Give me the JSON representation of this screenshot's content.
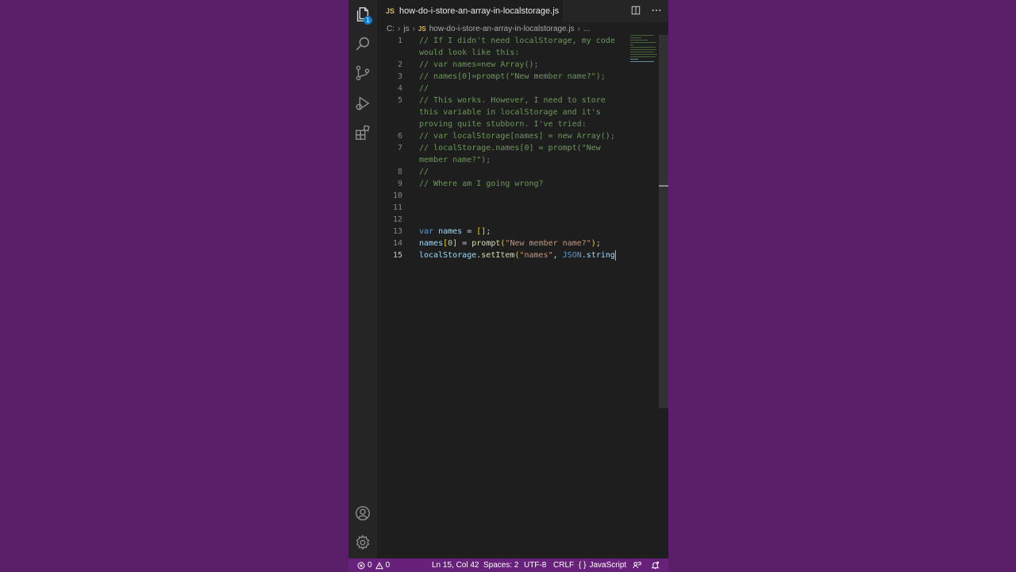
{
  "colors": {
    "background": "#5b1f6a",
    "editor_bg": "#1e1e1e",
    "statusbar_bg": "#68217a",
    "comment": "#6a9955",
    "keyword": "#569cd6",
    "string": "#ce9178"
  },
  "activity_bar": {
    "items": [
      {
        "icon": "files-icon",
        "badge": "1"
      },
      {
        "icon": "search-icon"
      },
      {
        "icon": "source-control-icon"
      },
      {
        "icon": "run-debug-icon"
      },
      {
        "icon": "extensions-icon"
      }
    ],
    "bottom": [
      {
        "icon": "account-icon"
      },
      {
        "icon": "gear-icon"
      }
    ]
  },
  "tab": {
    "lang_badge": "JS",
    "title": "how-do-i-store-an-array-in-localstorage.js"
  },
  "breadcrumb": {
    "drive": "C:",
    "folder": "js",
    "lang_badge": "JS",
    "file": "how-do-i-store-an-array-in-localstorage.js",
    "more": "..."
  },
  "code_lines": [
    {
      "num": "1",
      "text": "// If I didn't need localStorage, my code"
    },
    {
      "num": "",
      "text": "would look like this:"
    },
    {
      "num": "2",
      "text": "// var names=new Array();"
    },
    {
      "num": "3",
      "text": "// names[0]=prompt(\"New member name?\");"
    },
    {
      "num": "4",
      "text": "//"
    },
    {
      "num": "5",
      "text": "// This works. However, I need to store"
    },
    {
      "num": "",
      "text": "this variable in localStorage and it's"
    },
    {
      "num": "",
      "text": "proving quite stubborn. I've tried:"
    },
    {
      "num": "6",
      "text": "// var localStorage[names] = new Array();"
    },
    {
      "num": "7",
      "text": "// localStorage.names[0] = prompt(\"New"
    },
    {
      "num": "",
      "text": "member name?\");"
    },
    {
      "num": "8",
      "text": "//"
    },
    {
      "num": "9",
      "text": "// Where am I going wrong?"
    },
    {
      "num": "10",
      "text": ""
    },
    {
      "num": "11",
      "text": ""
    },
    {
      "num": "12",
      "text": ""
    },
    {
      "num": "13",
      "text": "var names = [];"
    },
    {
      "num": "14",
      "text": "names[0] = prompt(\"New member name?\");"
    },
    {
      "num": "15",
      "text": "localStorage.setItem(\"names\", JSON.string"
    }
  ],
  "code_tokens": {
    "l13": {
      "kw": "var",
      "var": "names",
      "op": " = ",
      "b": "[]",
      "end": ";"
    },
    "l14": {
      "var": "names",
      "b1": "[",
      "num": "0",
      "b2": "]",
      "op": " = ",
      "fn": "prompt",
      "p1": "(",
      "str": "\"New member name?\"",
      "p2": ")",
      "end": ";"
    },
    "l15": {
      "obj": "localStorage",
      "dot": ".",
      "fn": "setItem",
      "p1": "(",
      "str": "\"names\"",
      "comma": ", ",
      "cls": "JSON",
      "dot2": ".",
      "prop": "string"
    }
  },
  "status_bar": {
    "errors": "0",
    "warnings": "0",
    "position": "Ln 15, Col 42",
    "spaces": "Spaces: 2",
    "encoding": "UTF-8",
    "eol": "CRLF",
    "language": "JavaScript"
  }
}
